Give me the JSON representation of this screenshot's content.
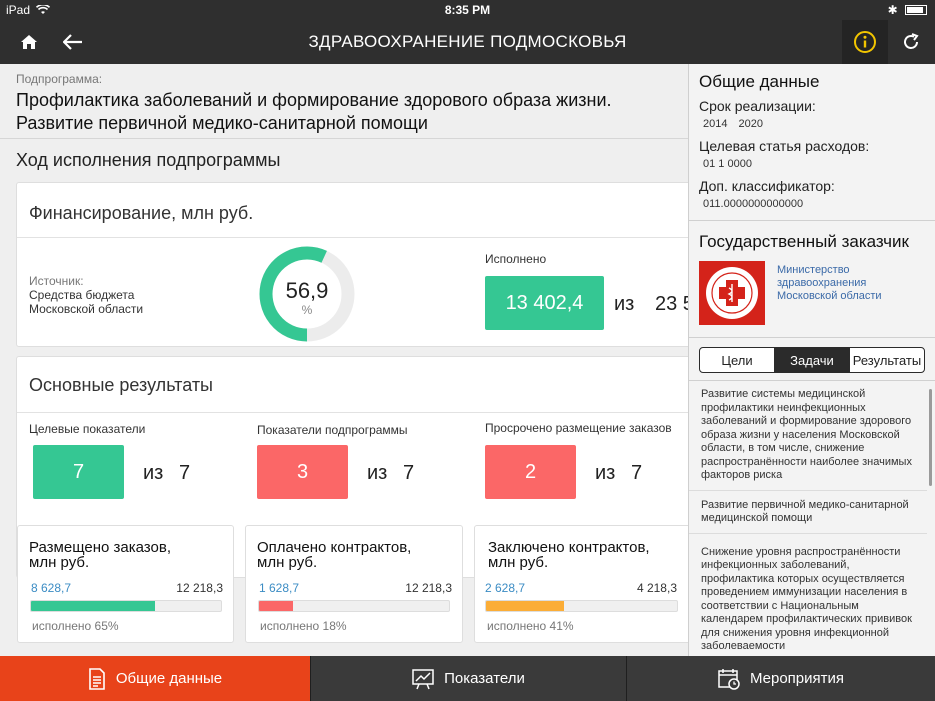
{
  "status_bar": {
    "carrier": "iPad",
    "time": "8:35 PM"
  },
  "header": {
    "title": "ЗДРАВООХРАНЕНИЕ ПОДМОСКОВЬЯ"
  },
  "subprogram": {
    "label": "Подпрограмма:",
    "title_line1": "Профилактика заболеваний и формирование здорового образа жизни.",
    "title_line2": "Развитие первичной медико-санитарной помощи"
  },
  "progress_section": {
    "title": "Ход исполнения подпрограммы"
  },
  "financing": {
    "title": "Финансирование, млн руб.",
    "source_label": "Источник:",
    "source_line1": "Средства бюджета",
    "source_line2": "Московской области",
    "gauge_value": "56,9",
    "gauge_unit": "%",
    "gauge_fraction": 0.569,
    "executed_label": "Исполнено",
    "executed_value": "13 402,4",
    "of_label": "из",
    "total_value": "23 5"
  },
  "results": {
    "title": "Основные результаты",
    "items": [
      {
        "label": "Целевые показатели",
        "value": "7",
        "of": "из",
        "total": "7",
        "color": "#35c793"
      },
      {
        "label": "Показатели подпрограммы",
        "value": "3",
        "of": "из",
        "total": "7",
        "color": "#fb6767"
      },
      {
        "label": "Просрочено размещение заказов",
        "value": "2",
        "of": "из",
        "total": "7",
        "color": "#fb6767"
      }
    ]
  },
  "contracts": [
    {
      "title_line1": "Размещено заказов,",
      "title_line2": "млн руб.",
      "value": "8 628,7",
      "total": "12 218,3",
      "percent_text": "исполнено 65%",
      "fraction": 0.65,
      "color": "#35c793"
    },
    {
      "title_line1": "Оплачено контрактов,",
      "title_line2": "млн руб.",
      "value": "1 628,7",
      "total": "12 218,3",
      "percent_text": "исполнено 18%",
      "fraction": 0.18,
      "color": "#fb6767"
    },
    {
      "title_line1": "Заключено контрактов,",
      "title_line2": "млн руб.",
      "value": "2 628,7",
      "total": "4 218,3",
      "percent_text": "исполнено 41%",
      "fraction": 0.41,
      "color": "#fbad37"
    }
  ],
  "panel": {
    "general_title": "Общие данные",
    "period_label": "Срок реализации:",
    "period_start": "2014",
    "period_end": "2020",
    "expense_label": "Целевая статья расходов:",
    "expense_value": "01 1 0000",
    "classifier_label": "Доп. классификатор:",
    "classifier_value": "011.0000000000000",
    "customer_title": "Государственный заказчик",
    "customer_name_line1": "Министерство",
    "customer_name_line2": "здравоохранения",
    "customer_name_line3": "Московской области",
    "segments": [
      "Цели",
      "Задачи",
      "Результаты"
    ],
    "active_segment": "Задачи",
    "tasks": [
      "Развитие системы медицинской профилактики неинфекционных заболеваний и формирование здорового образа жизни у населения Московской области, в том числе, снижение распространённости наиболее значимых факторов риска",
      "Развитие первичной медико-санитарной медицинской помощи",
      "Снижение уровня распространённости инфекционных заболеваний, профилактика которых осуществляется проведением иммунизации населения в соответствии с Национальным календарем профилактических прививок для снижения уровня инфекционной заболеваемости"
    ]
  },
  "tabs": [
    {
      "label": "Общие данные",
      "active": true
    },
    {
      "label": "Показатели",
      "active": false
    },
    {
      "label": "Мероприятия",
      "active": false
    }
  ],
  "colors": {
    "accent_orange": "#e8431a",
    "header_bg": "#2f2f2f",
    "info_yellow": "#f2c500",
    "link_blue": "#3b6aa8"
  }
}
